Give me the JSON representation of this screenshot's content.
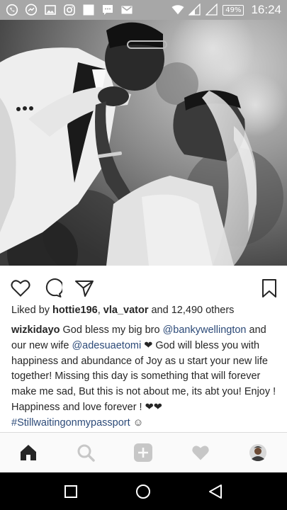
{
  "status_bar": {
    "icons": [
      "whatsapp-icon",
      "messenger-icon",
      "gallery-icon",
      "instagram-icon",
      "square-icon",
      "sms-icon",
      "gmail-icon",
      "wifi-icon",
      "signal-icon",
      "signal-empty-icon",
      "battery-icon"
    ],
    "battery": "49%",
    "time": "16:24"
  },
  "post": {
    "photo_description_icon": "wedding-photo",
    "actions": [
      "heart-icon",
      "comment-icon",
      "share-icon",
      "bookmark-icon"
    ],
    "likes": {
      "prefix": "Liked by ",
      "user1": "hottie196",
      "sep": ", ",
      "user2": "vla_vator",
      "suffix": " and 12,490 others"
    },
    "caption": {
      "username": "wizkidayo",
      "text1": " God bless my big bro ",
      "mention1": "@bankywellington",
      "text2": " and our new wife ",
      "mention2": "@adesuaetomi",
      "text3": " ❤ God will bless you with happiness and abundance of Joy as u start your new life together! Missing this day is something that will forever make me sad, But this is not about me, its abt you! Enjoy ! Happiness and love forever ! ❤❤ ",
      "hashtag": "#Stillwaitingonmypassport",
      "text4": " ☺"
    }
  },
  "tab_bar": {
    "items": [
      "home-icon",
      "search-icon",
      "add-post-icon",
      "activity-heart-icon",
      "profile-avatar"
    ]
  },
  "nav_bar": {
    "items": [
      "recents-icon",
      "home-circle-icon",
      "back-icon"
    ]
  },
  "colors": {
    "status_bar": "#a7a7a7",
    "link": "#2c4a78",
    "tab_inactive": "#c7c7c7"
  }
}
